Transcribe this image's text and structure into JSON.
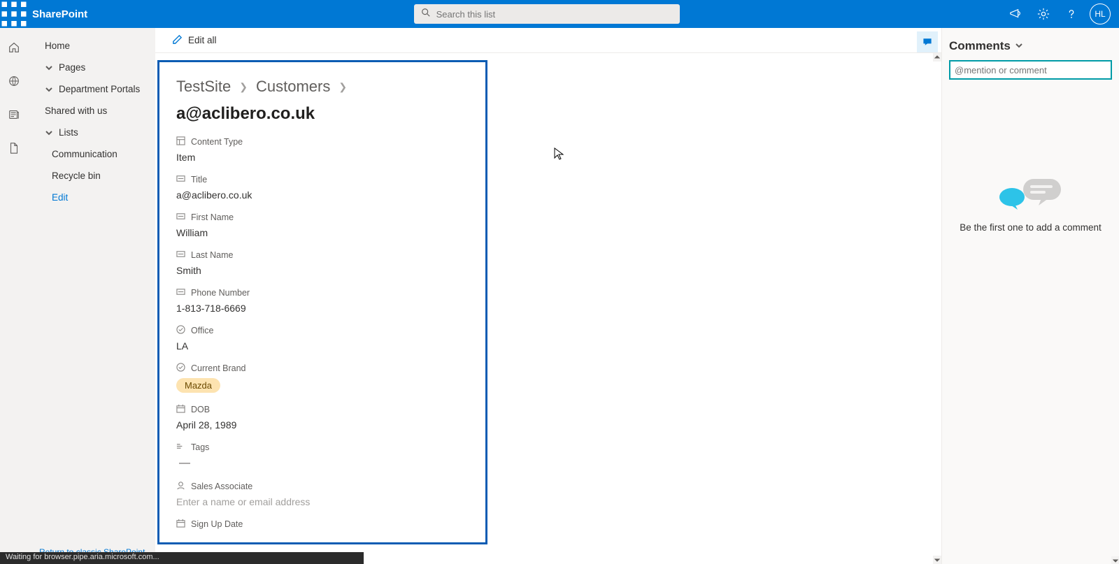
{
  "suite": {
    "brand": "SharePoint",
    "search_placeholder": "Search this list",
    "avatar_initials": "HL"
  },
  "nav": {
    "home": "Home",
    "pages": "Pages",
    "dept": "Department Portals",
    "shared": "Shared with us",
    "lists": "Lists",
    "comm": "Communication",
    "recycle": "Recycle bin",
    "edit": "Edit",
    "footer": "Return to classic SharePoint"
  },
  "cmd": {
    "edit_all": "Edit all"
  },
  "crumbs": {
    "site": "TestSite",
    "list": "Customers",
    "item": "a@aclibero.co.uk"
  },
  "fields": {
    "content_type": {
      "label": "Content Type",
      "value": "Item"
    },
    "title": {
      "label": "Title",
      "value": "a@aclibero.co.uk"
    },
    "first_name": {
      "label": "First Name",
      "value": "William"
    },
    "last_name": {
      "label": "Last Name",
      "value": "Smith"
    },
    "phone": {
      "label": "Phone Number",
      "value": "1-813-718-6669"
    },
    "office": {
      "label": "Office",
      "value": "LA"
    },
    "brand": {
      "label": "Current Brand",
      "value": "Mazda",
      "pill_bg": "#fde3b0"
    },
    "dob": {
      "label": "DOB",
      "value": "April 28, 1989"
    },
    "tags": {
      "label": "Tags",
      "value": "—"
    },
    "sales": {
      "label": "Sales Associate",
      "placeholder": "Enter a name or email address"
    },
    "signup": {
      "label": "Sign Up Date"
    }
  },
  "comments": {
    "header": "Comments",
    "placeholder": "@mention or comment",
    "empty_msg": "Be the first one to add a comment"
  },
  "status_bar": "Waiting for browser.pipe.aria.microsoft.com..."
}
